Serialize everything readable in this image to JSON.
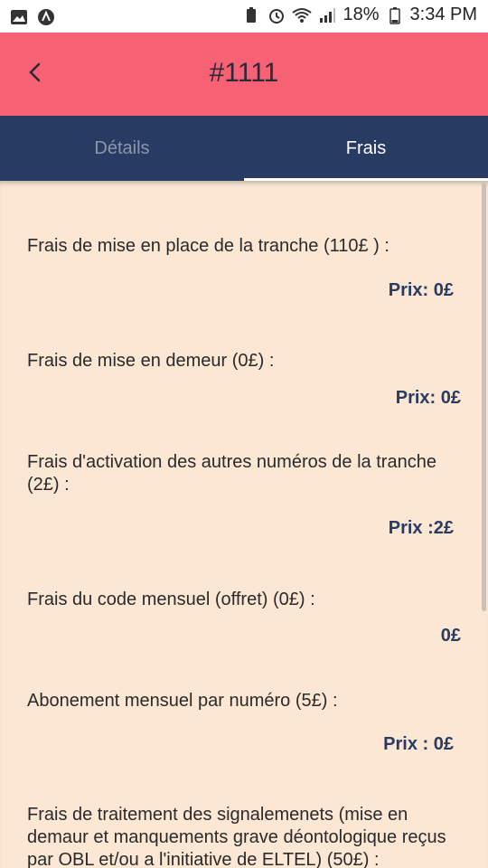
{
  "status_bar": {
    "battery": "18%",
    "time": "3:34 PM"
  },
  "header": {
    "title": "#1111"
  },
  "tabs": [
    {
      "label": "Détails",
      "active": false
    },
    {
      "label": "Frais",
      "active": true
    }
  ],
  "fees": [
    {
      "label": "Frais de mise en place de la tranche (110£ ) :",
      "price": "Prix: 0£"
    },
    {
      "label": "Frais de mise en demeur (0£) :",
      "price": "Prix: 0£"
    },
    {
      "label": "Frais d'activation des autres numéros de la tranche (2£) :",
      "price": "Prix :2£"
    },
    {
      "label": "Frais du code mensuel (offret) (0£) :",
      "price": "0£"
    },
    {
      "label": "Abonement mensuel par numéro (5£) :",
      "price": "Prix : 0£"
    },
    {
      "label": "Frais de traitement des signalemenets (mise en demaur et manquements grave déontologique reçus par OBL et/ou a l'initiative de ELTEL) (50£) :",
      "price": ""
    }
  ],
  "colors": {
    "header_bg": "#f66173",
    "tabs_bg": "#283b62",
    "content_bg": "#fbe7d4",
    "price_text": "#283b62"
  }
}
